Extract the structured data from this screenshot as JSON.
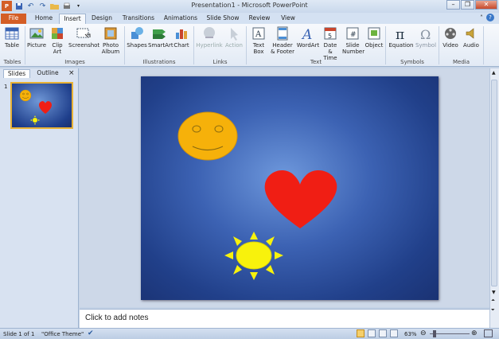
{
  "window": {
    "title": "Presentation1 - Microsoft PowerPoint"
  },
  "tabs": [
    {
      "label": "File"
    },
    {
      "label": "Home"
    },
    {
      "label": "Insert"
    },
    {
      "label": "Design"
    },
    {
      "label": "Transitions"
    },
    {
      "label": "Animations"
    },
    {
      "label": "Slide Show"
    },
    {
      "label": "Review"
    },
    {
      "label": "View"
    }
  ],
  "ribbon": {
    "table": "Table",
    "picture": "Picture",
    "clipart": "Clip Art",
    "screenshot": "Screenshot",
    "photoalbum": "Photo Album",
    "shapes": "Shapes",
    "smartart": "SmartArt",
    "chart": "Chart",
    "hyperlink": "Hyperlink",
    "action": "Action",
    "textbox": "Text Box",
    "headerfooter": "Header & Footer",
    "wordart": "WordArt",
    "datetime": "Date & Time",
    "slidenumber": "Slide Number",
    "object": "Object",
    "equation": "Equation",
    "symbol": "Symbol",
    "video": "Video",
    "audio": "Audio",
    "groups": {
      "tables": "Tables",
      "images": "Images",
      "illustrations": "Illustrations",
      "links": "Links",
      "text": "Text",
      "symbols": "Symbols",
      "media": "Media"
    }
  },
  "panel": {
    "slides_tab": "Slides",
    "outline_tab": "Outline",
    "close": "×",
    "slide_num": "1"
  },
  "notes": {
    "placeholder": "Click to add notes"
  },
  "status": {
    "slide": "Slide 1 of 1",
    "theme": "\"Office Theme\"",
    "zoom": "63%"
  },
  "colors": {
    "accent": "#d45e26",
    "slide_bg": "#2f55a8",
    "smiley": "#f6b10a",
    "heart": "#f01e14",
    "sun": "#f8f20c"
  }
}
